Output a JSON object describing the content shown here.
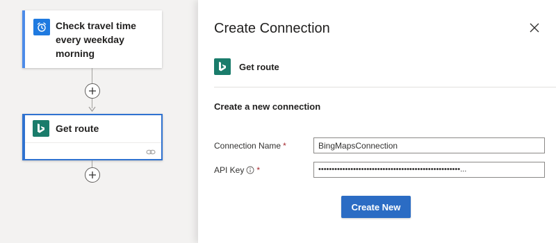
{
  "canvas": {
    "trigger": {
      "title": "Check travel time every weekday morning",
      "icon": "alarm-clock-icon"
    },
    "action": {
      "title": "Get route",
      "icon": "bing-logo-icon",
      "footer_icon": "link-icon"
    },
    "add_step_icon": "plus-circle-icon"
  },
  "panel": {
    "title": "Create Connection",
    "close_icon": "close-icon",
    "connector": {
      "name": "Get route",
      "icon": "bing-logo-icon"
    },
    "section_title": "Create a new connection",
    "fields": {
      "connection_name": {
        "label": "Connection Name",
        "required": "*",
        "value": "BingMapsConnection"
      },
      "api_key": {
        "label": "API Key",
        "required": "*",
        "info_icon": "info-icon",
        "value": "•••••••••••••••••••••••••••••••••••••••••••••••••••••..."
      }
    },
    "create_button": "Create New"
  },
  "colors": {
    "accent": "#2b6cc4",
    "bing_teal": "#1a7c6b",
    "trigger_blue": "#1f7ae0",
    "required_red": "#a4262c"
  }
}
